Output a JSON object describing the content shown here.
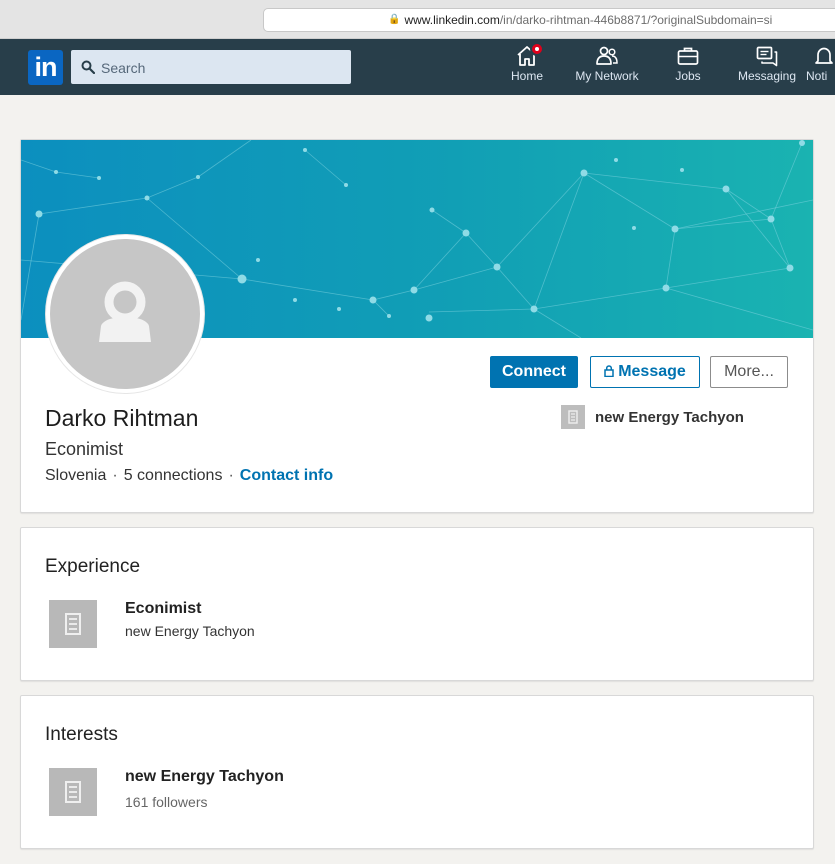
{
  "browser": {
    "url_host": "www.linkedin.com",
    "url_path": "/in/darko-rihtman-446b8871/?originalSubdomain=si"
  },
  "nav": {
    "logo_text": "in",
    "search_placeholder": "Search",
    "items": [
      {
        "label": "Home",
        "icon": "home-icon"
      },
      {
        "label": "My Network",
        "icon": "network-icon"
      },
      {
        "label": "Jobs",
        "icon": "briefcase-icon"
      },
      {
        "label": "Messaging",
        "icon": "messaging-icon"
      },
      {
        "label": "Noti",
        "icon": "bell-icon"
      }
    ]
  },
  "profile": {
    "name": "Darko Rihtman",
    "headline": "Econimist",
    "location": "Slovenia",
    "connections": "5 connections",
    "contact_info": "Contact info",
    "company": "new Energy Tachyon",
    "buttons": {
      "connect": "Connect",
      "message": "Message",
      "more": "More..."
    }
  },
  "experience": {
    "title": "Experience",
    "items": [
      {
        "role": "Econimist",
        "company": "new Energy Tachyon"
      }
    ]
  },
  "interests": {
    "title": "Interests",
    "items": [
      {
        "name": "new Energy Tachyon",
        "followers": "161 followers"
      }
    ]
  },
  "colors": {
    "nav_bg": "#283e4a",
    "brand_blue": "#0073b1",
    "logo_blue": "#0a66c2",
    "cover_start": "#0e93b8",
    "cover_end": "#1ab2b2",
    "notification_red": "#e0001b"
  }
}
